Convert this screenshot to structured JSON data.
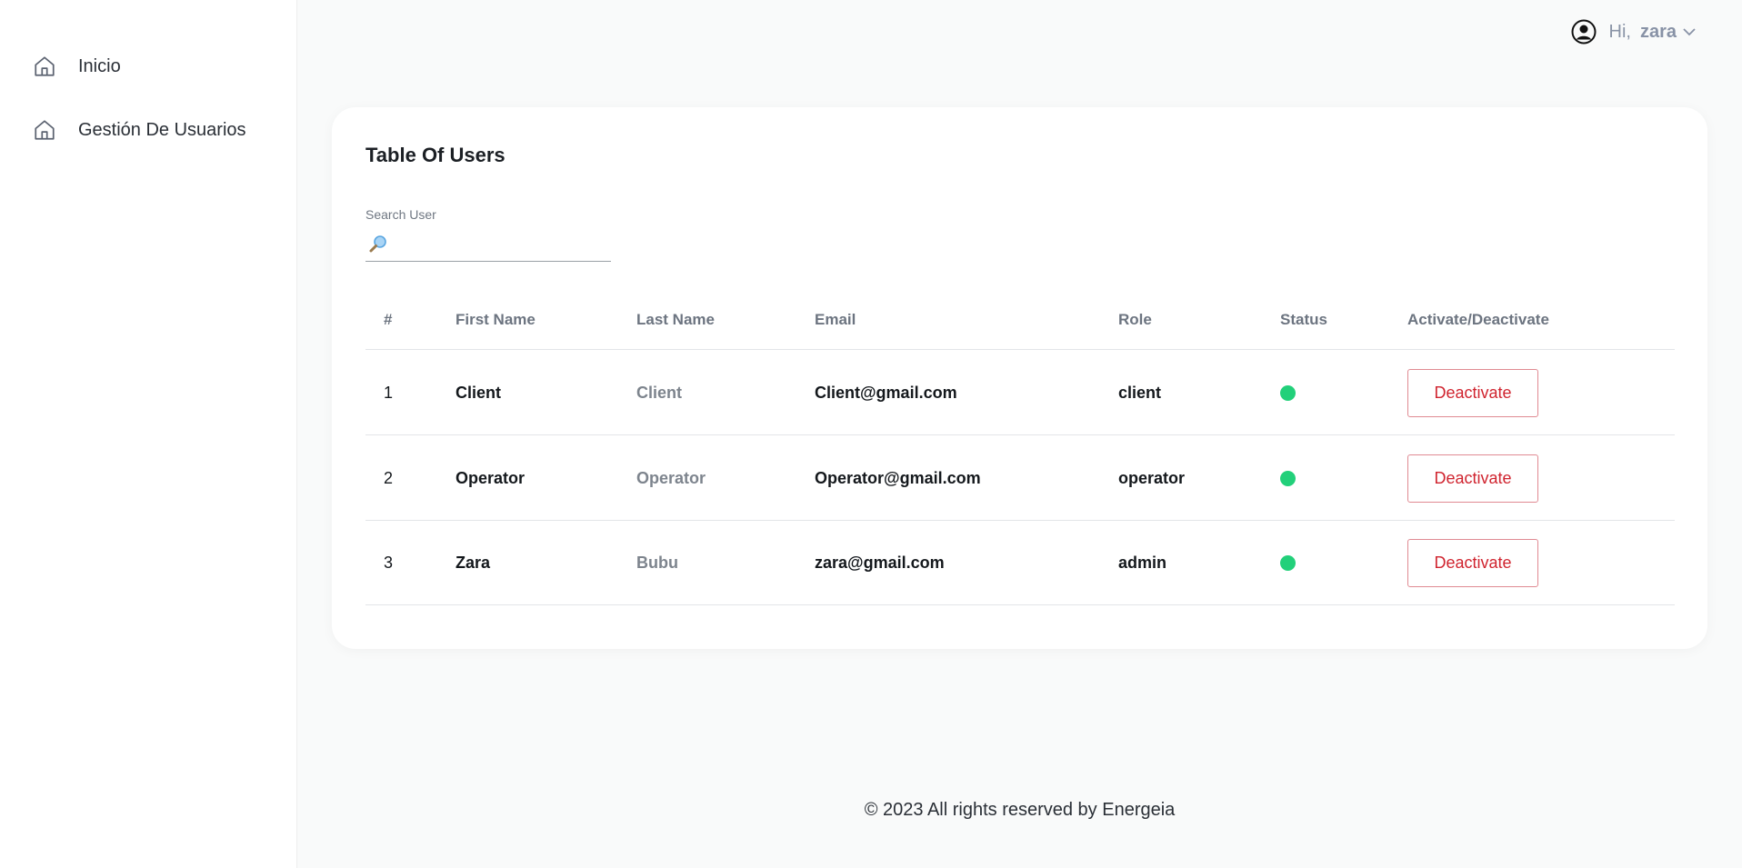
{
  "sidebar": {
    "items": [
      {
        "label": "Inicio",
        "icon": "home-icon"
      },
      {
        "label": "Gestión De Usuarios",
        "icon": "home-icon"
      }
    ]
  },
  "header": {
    "greeting": "Hi,",
    "username": "zara"
  },
  "card": {
    "title": "Table Of Users",
    "search": {
      "label": "Search User",
      "value": "",
      "placeholder": ""
    }
  },
  "table": {
    "columns": [
      "#",
      "First Name",
      "Last Name",
      "Email",
      "Role",
      "Status",
      "Activate/Deactivate"
    ],
    "rows": [
      {
        "num": "1",
        "first": "Client",
        "last": "Client",
        "email": "Client@gmail.com",
        "role": "client",
        "status": "active",
        "action": "Deactivate"
      },
      {
        "num": "2",
        "first": "Operator",
        "last": "Operator",
        "email": "Operator@gmail.com",
        "role": "operator",
        "status": "active",
        "action": "Deactivate"
      },
      {
        "num": "3",
        "first": "Zara",
        "last": "Bubu",
        "email": "zara@gmail.com",
        "role": "admin",
        "status": "active",
        "action": "Deactivate"
      }
    ]
  },
  "colors": {
    "status_active": "#22d07a",
    "danger": "#d0242f"
  },
  "footer": {
    "text": "© 2023 All rights reserved by Energeia"
  }
}
